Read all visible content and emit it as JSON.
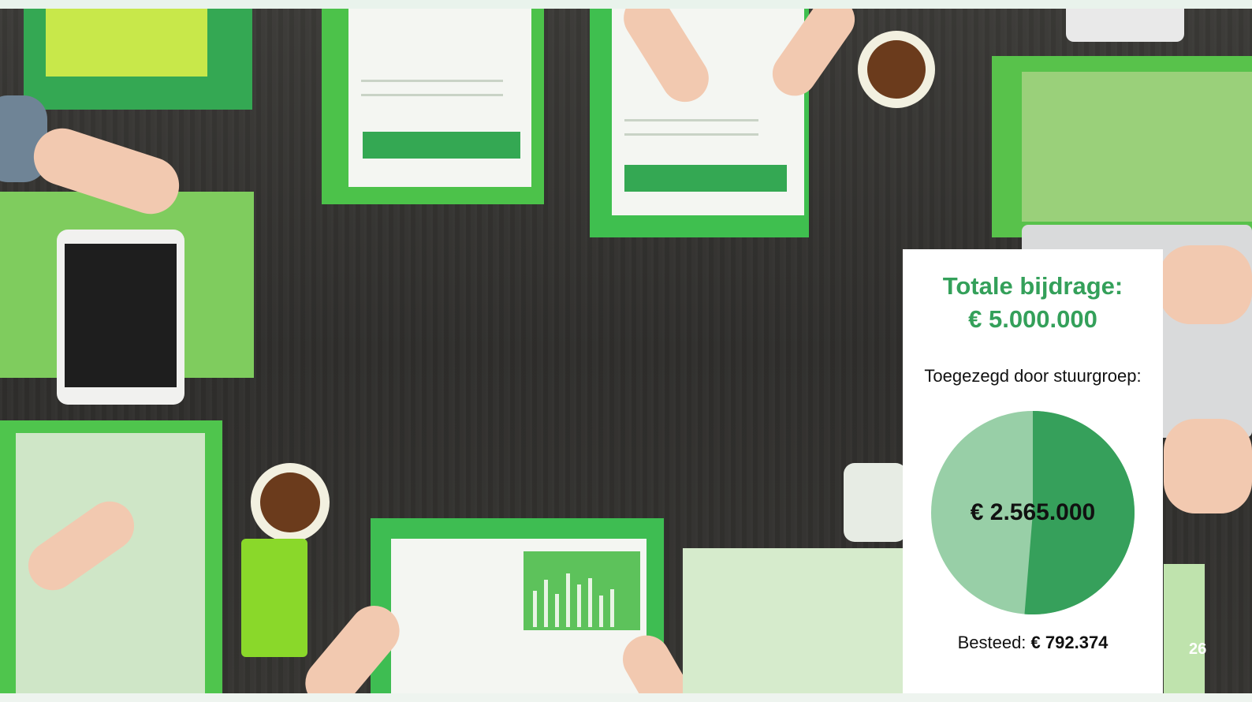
{
  "card": {
    "title_line1": "Totale bijdrage:",
    "title_line2": "€ 5.000.000",
    "committed_label": "Toegezegd door stuurgroep:",
    "pie_value_label": "€ 2.565.000",
    "spent_label": "Besteed:",
    "spent_value": "€ 792.374"
  },
  "pie": {
    "total": 5000000,
    "committed": 2565000,
    "color_committed": "#36a05b",
    "color_remaining": "#98cfa7"
  },
  "slide": {
    "page_number": "26"
  },
  "colors": {
    "accent": "#34a05a",
    "background": "#eef4ef"
  },
  "background_photo": {
    "icon": "office-desk-photo"
  }
}
